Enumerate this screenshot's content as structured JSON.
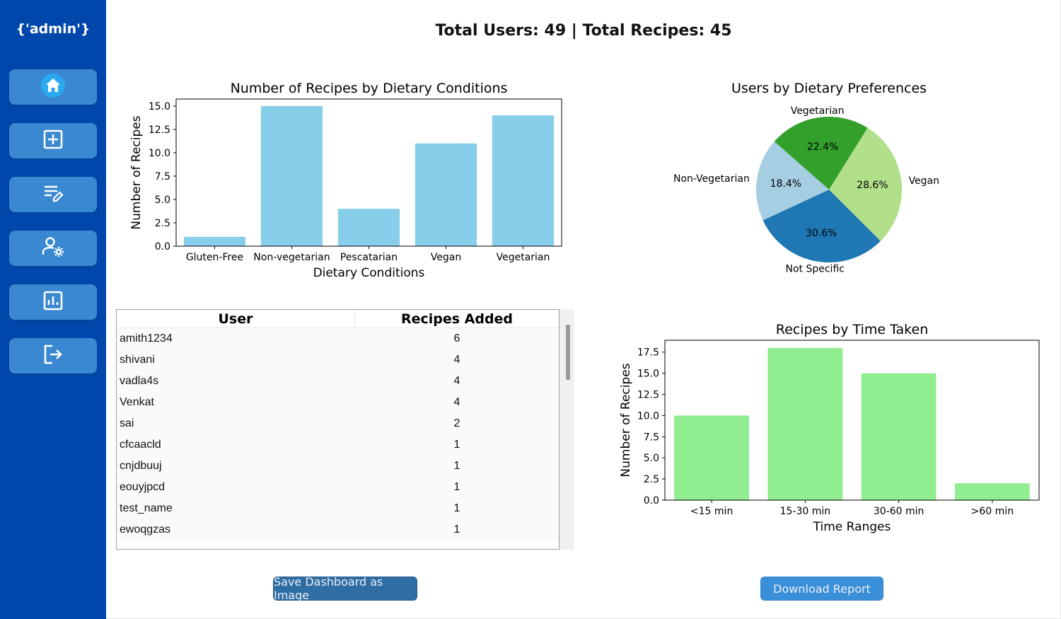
{
  "sidebar": {
    "title": "{'admin'}",
    "items": [
      {
        "icon": "home-icon",
        "label": "Home"
      },
      {
        "icon": "add-box-icon",
        "label": "Add Recipe"
      },
      {
        "icon": "edit-list-icon",
        "label": "Edit Recipes"
      },
      {
        "icon": "manage-users-icon",
        "label": "Manage Users"
      },
      {
        "icon": "analytics-icon",
        "label": "Analytics"
      },
      {
        "icon": "logout-icon",
        "label": "Logout"
      }
    ],
    "bg_color": "#0047ab",
    "button_color": "#3a88d2"
  },
  "summary": "Total Users: 49 | Total Recipes: 45",
  "table": {
    "columns": [
      "User",
      "Recipes Added"
    ],
    "rows": [
      [
        "amith1234",
        "6"
      ],
      [
        "shivani",
        "4"
      ],
      [
        "vadla4s",
        "4"
      ],
      [
        "Venkat",
        "4"
      ],
      [
        "sai",
        "2"
      ],
      [
        "cfcaacld",
        "1"
      ],
      [
        "cnjdbuuj",
        "1"
      ],
      [
        "eouyjpcd",
        "1"
      ],
      [
        "test_name",
        "1"
      ],
      [
        "ewoqgzas",
        "1"
      ]
    ]
  },
  "buttons": {
    "save": "Save Dashboard as Image",
    "download": "Download Report"
  },
  "chart_data": [
    {
      "type": "bar",
      "title": "Number of Recipes by Dietary Conditions",
      "xlabel": "Dietary Conditions",
      "ylabel": "Number of Recipes",
      "categories": [
        "Gluten-Free",
        "Non-vegetarian",
        "Pescatarian",
        "Vegan",
        "Vegetarian"
      ],
      "values": [
        1,
        15,
        4,
        11,
        14
      ],
      "ylim": [
        0,
        15.75
      ],
      "yticks": [
        "0.0",
        "2.5",
        "5.0",
        "7.5",
        "10.0",
        "12.5",
        "15.0"
      ],
      "color": "#87ceeb"
    },
    {
      "type": "pie",
      "title": "Users by Dietary Preferences",
      "slices": [
        {
          "label": "Vegan",
          "value": 28.6,
          "pct": "28.6%",
          "color": "#b2df8a"
        },
        {
          "label": "Not Specific",
          "value": 30.6,
          "pct": "30.6%",
          "color": "#1f78b4"
        },
        {
          "label": "Non-Vegetarian",
          "value": 18.4,
          "pct": "18.4%",
          "color": "#a6cee3"
        },
        {
          "label": "Vegetarian",
          "value": 22.4,
          "pct": "22.4%",
          "color": "#33a02c"
        }
      ]
    },
    {
      "type": "bar",
      "title": "Recipes by Time Taken",
      "xlabel": "Time Ranges",
      "ylabel": "Number of Recipes",
      "categories": [
        "<15 min",
        "15-30 min",
        "30-60 min",
        ">60 min"
      ],
      "values": [
        10,
        18,
        15,
        2
      ],
      "ylim": [
        0,
        18.9
      ],
      "yticks": [
        "0.0",
        "2.5",
        "5.0",
        "7.5",
        "10.0",
        "12.5",
        "15.0",
        "17.5"
      ],
      "color": "#90ee90"
    }
  ]
}
